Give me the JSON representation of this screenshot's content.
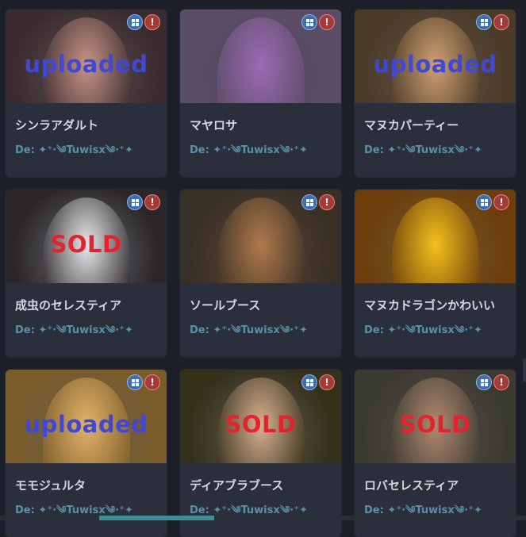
{
  "cards": [
    {
      "name": "シンラアダルト",
      "author_prefix": "De:",
      "author": "✦⁺·༄Tuwisx༄·⁺✦",
      "stamp": "uploaded",
      "platform_icon": "windows-icon",
      "warn_icon": "alert-icon",
      "colors": {
        "bg": "#3a2c2e",
        "figure": "#c79387"
      }
    },
    {
      "name": "マヤロサ",
      "author_prefix": "De:",
      "author": "✦⁺·༄Tuwisx༄·⁺✦",
      "stamp": "",
      "platform_icon": "windows-icon",
      "warn_icon": "alert-icon",
      "colors": {
        "bg": "#5c4d66",
        "figure": "#9b69b4"
      }
    },
    {
      "name": "マヌカパーティー",
      "author_prefix": "De:",
      "author": "✦⁺·༄Tuwisx༄·⁺✦",
      "stamp": "uploaded",
      "platform_icon": "windows-icon",
      "warn_icon": "alert-icon",
      "colors": {
        "bg": "#4a3a28",
        "figure": "#d0a070"
      }
    },
    {
      "name": "成虫のセレスティア",
      "author_prefix": "De:",
      "author": "✦⁺·༄Tuwisx༄·⁺✦",
      "stamp": "SOLD",
      "platform_icon": "windows-icon",
      "warn_icon": "alert-icon",
      "colors": {
        "bg": "#2b2628",
        "figure": "#e8e8ec"
      }
    },
    {
      "name": "ソールブース",
      "author_prefix": "De:",
      "author": "✦⁺·༄Tuwisx༄·⁺✦",
      "stamp": "",
      "platform_icon": "windows-icon",
      "warn_icon": "alert-icon",
      "colors": {
        "bg": "#3a2f24",
        "figure": "#b07a4c"
      }
    },
    {
      "name": "マヌカドラゴンかわいい",
      "author_prefix": "De:",
      "author": "✦⁺·༄Tuwisx༄·⁺✦",
      "stamp": "",
      "platform_icon": "windows-icon",
      "warn_icon": "alert-icon",
      "colors": {
        "bg": "#6d3d0c",
        "figure": "#f2c11c"
      }
    },
    {
      "name": "モモジュルタ",
      "author_prefix": "De:",
      "author": "✦⁺·༄Tuwisx༄·⁺✦",
      "stamp": "uploaded",
      "platform_icon": "windows-icon",
      "warn_icon": "alert-icon",
      "colors": {
        "bg": "#7a5c2a",
        "figure": "#e3b26a"
      }
    },
    {
      "name": "ディアブラブース",
      "author_prefix": "De:",
      "author": "✦⁺·༄Tuwisx༄·⁺✦",
      "stamp": "SOLD",
      "platform_icon": "windows-icon",
      "warn_icon": "alert-icon",
      "colors": {
        "bg": "#34301a",
        "figure": "#d8b090"
      }
    },
    {
      "name": "ロバセレスティア",
      "author_prefix": "De:",
      "author": "✦⁺·༄Tuwisx༄·⁺✦",
      "stamp": "SOLD",
      "platform_icon": "windows-icon",
      "warn_icon": "alert-icon",
      "colors": {
        "bg": "#3b3a30",
        "figure": "#b08870"
      }
    }
  ]
}
